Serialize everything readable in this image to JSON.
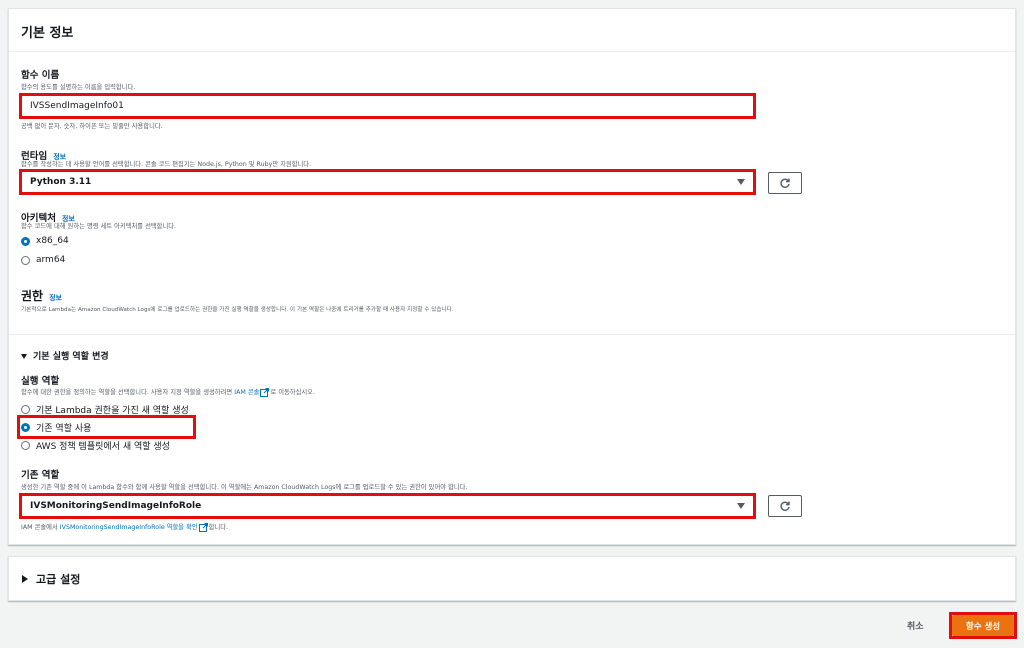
{
  "basic_info": {
    "title": "기본 정보",
    "function_name": {
      "label": "함수 이름",
      "description": "함수의 용도를 설명하는 이름을 입력합니다.",
      "value": "IVSSendImageInfo01",
      "hint": "공백 없이 문자, 숫자, 하이픈 또는 밑줄만 사용합니다."
    },
    "runtime": {
      "label": "런타임",
      "info": "정보",
      "description": "함수를 작성하는 데 사용할 언어를 선택합니다. 콘솔 코드 편집기는 Node.js, Python 및 Ruby만 지원합니다.",
      "value": "Python 3.11"
    },
    "architecture": {
      "label": "아키텍처",
      "info": "정보",
      "description": "함수 코드에 대해 원하는 명령 세트 아키텍처를 선택합니다.",
      "options": [
        "x86_64",
        "arm64"
      ],
      "selected": "x86_64"
    },
    "permissions": {
      "title": "권한",
      "info": "정보",
      "description": "기본적으로 Lambda는 Amazon CloudWatch Logs에 로그를 업로드하는 권한을 가진 실행 역할을 생성합니다. 이 기본 역할은 나중에 트리거를 추가할 때 사용자 지정할 수 있습니다."
    },
    "change_role": {
      "toggle_label": "기본 실행 역할 변경",
      "execution_role_label": "실행 역할",
      "execution_role_desc_prefix": "함수에 대한 권한을 정의하는 역할을 선택합니다. 사용자 지정 역할을 생성하려면",
      "execution_role_desc_link": "IAM 콘솔",
      "execution_role_desc_suffix": "로 이동하십시오.",
      "options": [
        "기본 Lambda 권한을 가진 새 역할 생성",
        "기존 역할 사용",
        "AWS 정책 템플릿에서 새 역할 생성"
      ],
      "selected": "기존 역할 사용",
      "existing_role_label": "기존 역할",
      "existing_role_desc": "생성한 기존 역할 중에 이 Lambda 함수와 함께 사용할 역할을 선택합니다. 이 역할에는 Amazon CloudWatch Logs에 로그를 업로드할 수 있는 권한이 있어야 합니다.",
      "existing_role_value": "IVSMonitoringSendImageInfoRole",
      "footer_prefix": "IAM 콘솔에서",
      "footer_link": "IVSMonitoringSendImageInfoRole 역할을 확인",
      "footer_suffix": "합니다."
    }
  },
  "advanced": {
    "title": "고급 설정"
  },
  "actions": {
    "cancel": "취소",
    "create": "함수 생성"
  },
  "colors": {
    "highlight": "#e20d0d",
    "primary_button": "#ec7211",
    "link": "#0073bb"
  }
}
